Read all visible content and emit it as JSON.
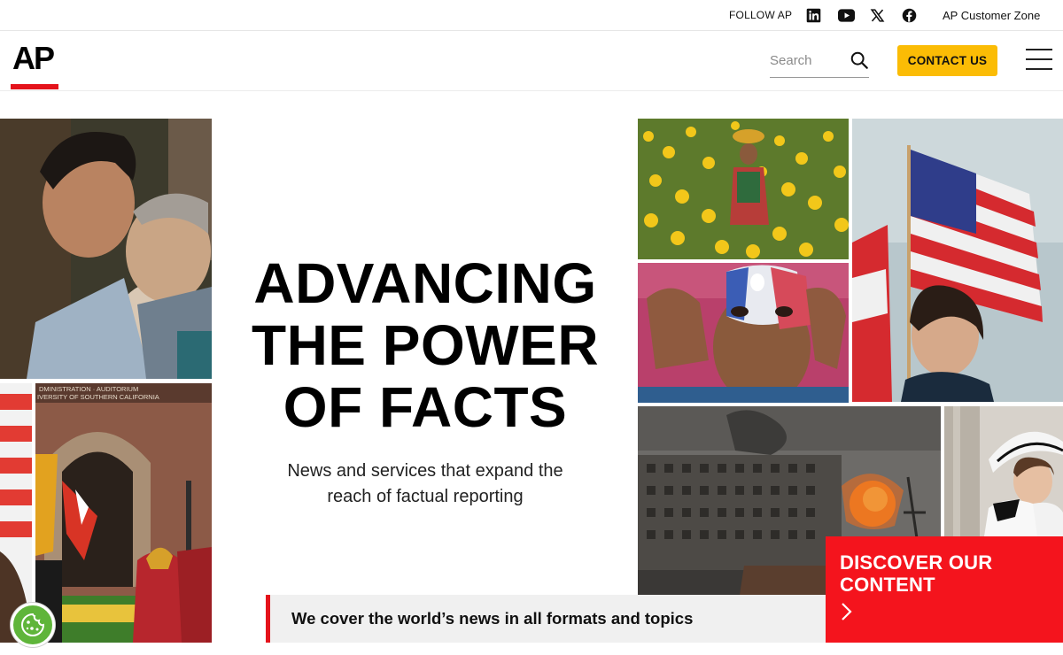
{
  "topbar": {
    "follow_label": "FOLLOW AP",
    "social": [
      "linkedin-icon",
      "youtube-icon",
      "x-icon",
      "facebook-icon"
    ],
    "customer_zone": "AP Customer Zone"
  },
  "header": {
    "logo": "AP",
    "search_placeholder": "Search",
    "contact_label": "CONTACT US"
  },
  "hero": {
    "title_line1": "ADVANCING",
    "title_line2": "THE POWER",
    "title_line3": "OF FACTS",
    "subtitle_line1": "News and services that expand the",
    "subtitle_line2": "reach of factual reporting"
  },
  "photos": {
    "usc_sign_line1": "DMINISTRATION · AUDITORIUM",
    "usc_sign_line2": "IVERSITY OF SOUTHERN CALIFORNIA"
  },
  "cover_strip": "We cover the world’s news in all formats and topics",
  "discover": {
    "label_line1": "DISCOVER OUR",
    "label_line2": "CONTENT"
  },
  "colors": {
    "brand_red": "#e4131b",
    "button_yellow": "#fbbc05",
    "discover_red": "#f4141d",
    "cookie_green": "#5fb53a"
  }
}
